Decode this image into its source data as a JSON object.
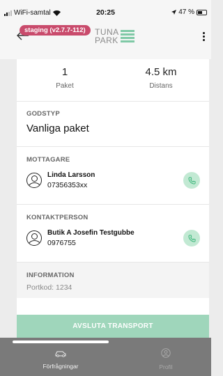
{
  "status_bar": {
    "carrier": "WiFi-samtal",
    "time": "20:25",
    "battery": "47 %"
  },
  "header": {
    "badge": "staging (v2.7.7-112)",
    "logo_line1": "TUNA",
    "logo_line2": "PARK"
  },
  "stats": [
    {
      "value": "1",
      "label": "Paket"
    },
    {
      "value": "4.5 km",
      "label": "Distans"
    }
  ],
  "goods": {
    "label": "GODSTYP",
    "value": "Vanliga paket"
  },
  "recipient": {
    "label": "MOTTAGARE",
    "name": "Linda Larsson",
    "phone": "07356353xx"
  },
  "contact": {
    "label": "KONTAKTPERSON",
    "name": "Butik A Josefin Testgubbe",
    "phone": "0976755"
  },
  "information": {
    "label": "INFORMATION",
    "value": "Portkod: 1234"
  },
  "finish_button": "AVSLUTA TRANSPORT",
  "tabs": [
    {
      "label": "Förfrågningar",
      "icon": "car-icon"
    },
    {
      "label": "Profil",
      "icon": "profile-icon"
    }
  ],
  "colors": {
    "accent": "#9fd6bb",
    "badge": "#c94b6c",
    "call": "#c2e9d3"
  }
}
